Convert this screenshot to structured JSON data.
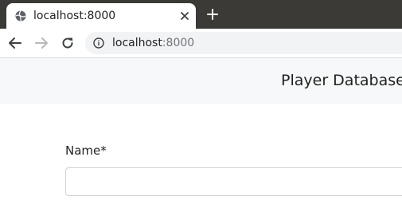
{
  "browser": {
    "tab": {
      "title": "localhost:8000",
      "favicon_icon": "globe-icon",
      "close_icon": "close-icon"
    },
    "new_tab_icon": "plus-icon",
    "toolbar": {
      "back_icon": "arrow-left-icon",
      "forward_icon": "arrow-right-icon",
      "reload_icon": "reload-icon",
      "info_icon": "info-icon",
      "url_host": "localhost",
      "url_port": ":8000"
    }
  },
  "navbar": {
    "brand": "Player Database"
  },
  "form": {
    "name_label": "Name*",
    "name_value": "",
    "name_placeholder": ""
  },
  "colors": {
    "tabbar_bg": "#3b3a36",
    "navbar_bg": "#f7f8f9",
    "forward_disabled": "#b8b8b8"
  }
}
